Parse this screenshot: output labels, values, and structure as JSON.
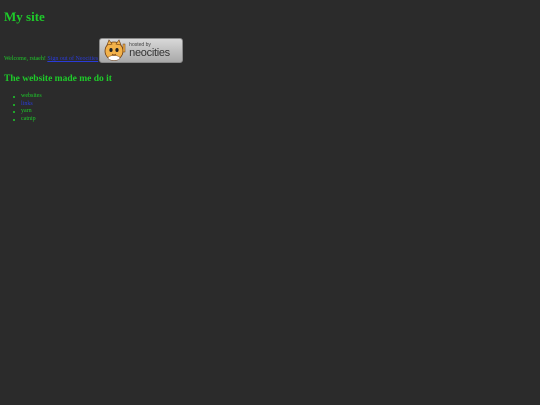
{
  "site": {
    "title": "My site"
  },
  "welcome": {
    "text": "Welcome, rstaeh!",
    "link_text": "Sign out of Neocities"
  },
  "badge": {
    "small_text": "hosted by",
    "brand_text": "neocities",
    "icon": "neocities-cat-icon"
  },
  "section": {
    "heading": "The website made me do it"
  },
  "list": {
    "items": [
      {
        "label": "websites",
        "is_link": false
      },
      {
        "label": "links",
        "is_link": true
      },
      {
        "label": "yarn",
        "is_link": false
      },
      {
        "label": "catnip",
        "is_link": false
      }
    ]
  },
  "colors": {
    "background": "#2b2b2b",
    "text": "#1ecb2a",
    "link": "#2a3bd8"
  }
}
